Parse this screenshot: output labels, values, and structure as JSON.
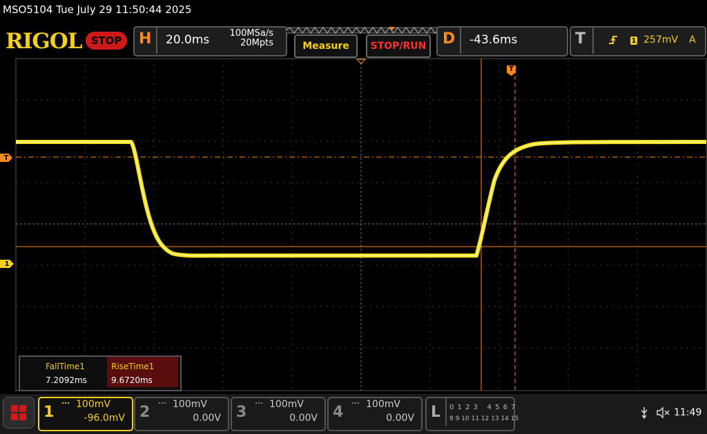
{
  "header": {
    "title": "MSO5104  Tue July 29 11:50:44 2025",
    "logo": "RIGOL",
    "run_state": "STOP"
  },
  "horizontal": {
    "letter": "H",
    "timebase": "20.0ms",
    "sample_rate": "100MSa/s",
    "memory_depth": "20Mpts"
  },
  "buttons": {
    "measure": "Measure",
    "stop_run": "STOP/RUN"
  },
  "delay": {
    "letter": "D",
    "value": "-43.6ms"
  },
  "trigger": {
    "letter": "T",
    "slope_icon": "rising-edge-icon",
    "channel": "1",
    "level": "257mV",
    "mode": "A"
  },
  "markers": {
    "trigger_level": "T",
    "channel1": "1",
    "trigger_pos": "T"
  },
  "measurements": [
    {
      "label": "FallTime1",
      "value": "7.2092ms"
    },
    {
      "label": "RiseTime1",
      "value": "9.6720ms"
    }
  ],
  "channels": [
    {
      "num": "1",
      "scale": "100mV",
      "offset": "-96.0mV",
      "active": true
    },
    {
      "num": "2",
      "scale": "100mV",
      "offset": "0.00V",
      "active": false
    },
    {
      "num": "3",
      "scale": "100mV",
      "offset": "0.00V",
      "active": false
    },
    {
      "num": "4",
      "scale": "100mV",
      "offset": "0.00V",
      "active": false
    }
  ],
  "logic": {
    "letter": "L",
    "row1": "0 1 2 3   4 5 6 7",
    "row2": "8 9 10 11 12 13 14 15"
  },
  "status": {
    "usb_icon": "usb-icon",
    "sound_icon": "speaker-muted-icon",
    "time": "11:49"
  },
  "colors": {
    "channel1": "#f5cf1d",
    "accent": "#ff8a1a",
    "stop": "#d01a1a"
  }
}
